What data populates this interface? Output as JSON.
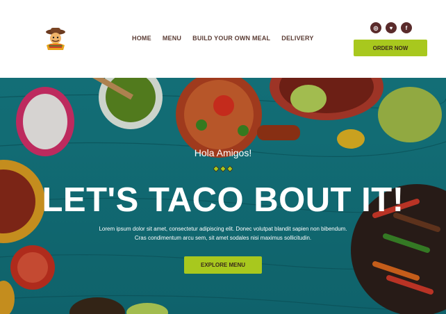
{
  "header": {
    "logo_icon": "taco-mascot-logo",
    "nav": [
      {
        "label": "HOME"
      },
      {
        "label": "MENU"
      },
      {
        "label": "BUILD YOUR OWN MEAL"
      },
      {
        "label": "DELIVERY"
      }
    ],
    "socials": [
      {
        "icon": "instagram-icon",
        "glyph": "◎"
      },
      {
        "icon": "twitter-icon",
        "glyph": "♥"
      },
      {
        "icon": "facebook-icon",
        "glyph": "f"
      }
    ],
    "order_label": "ORDER NOW"
  },
  "hero": {
    "greeting": "Hola Amigos!",
    "headline": "LET'S TACO BOUT IT!",
    "lorem_line1": "Lorem ipsum dolor sit amet, consectetur adipiscing elit. Donec volutpat blandit sapien non bibendum.",
    "lorem_line2": "Cras condimentum arcu sem, sit amet sodales nisi maximus sollicitudin.",
    "explore_label": "EXPLORE MENU"
  },
  "colors": {
    "accent": "#a8c81e",
    "nav_text": "#5a3b33",
    "social_bg": "#5a2b2b",
    "hero_teal": "#1c8b93"
  }
}
